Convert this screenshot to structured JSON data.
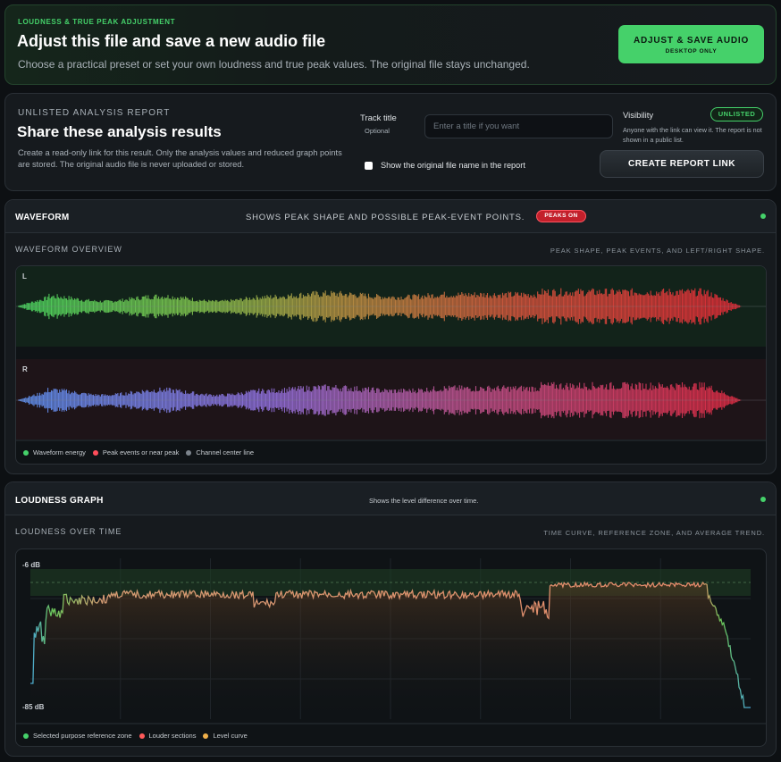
{
  "adjust": {
    "eyebrow": "LOUDNESS & TRUE PEAK ADJUSTMENT",
    "title": "Adjust this file and save a new audio file",
    "subtitle": "Choose a practical preset or set your own loudness and true peak values. The original file stays unchanged.",
    "button_label": "ADJUST & SAVE AUDIO",
    "button_sublabel": "DESKTOP ONLY"
  },
  "report": {
    "eyebrow": "UNLISTED ANALYSIS REPORT",
    "title": "Share these analysis results",
    "description": "Create a read-only link for this result. Only the analysis values and reduced graph points are stored. The original audio file is never uploaded or stored.",
    "track_title_label": "Track title",
    "track_title_optional": "Optional",
    "track_title_placeholder": "Enter a title if you want",
    "track_title_value": "",
    "show_filename_label": "Show the original file name in the report",
    "show_filename_checked": false,
    "visibility_label": "Visibility",
    "visibility_badge": "UNLISTED",
    "visibility_desc": "Anyone with the link can view it. The report is not shown in a public list.",
    "create_button": "CREATE REPORT LINK"
  },
  "waveform": {
    "title": "WAVEFORM",
    "note": "SHOWS PEAK SHAPE AND POSSIBLE PEAK-EVENT POINTS.",
    "badge": "PEAKS ON",
    "sub_title": "WAVEFORM OVERVIEW",
    "sub_right": "PEAK SHAPE, PEAK EVENTS, AND LEFT/RIGHT SHAPE.",
    "channels": [
      "L",
      "R"
    ],
    "legend": [
      {
        "label": "Waveform energy",
        "color": "#45d16a"
      },
      {
        "label": "Peak events or near peak",
        "color": "#ff4d5a"
      },
      {
        "label": "Channel center line",
        "color": "#7c848c"
      }
    ]
  },
  "loudness": {
    "title": "LOUDNESS GRAPH",
    "note": "Shows the level difference over time.",
    "sub_title": "LOUDNESS OVER TIME",
    "sub_right": "TIME CURVE, REFERENCE ZONE, AND AVERAGE TREND.",
    "y_top_label": "-6 dB",
    "y_bottom_label": "-85 dB",
    "legend": [
      {
        "label": "Selected purpose reference zone",
        "color": "#45d16a"
      },
      {
        "label": "Louder sections",
        "color": "#ff5a5a"
      },
      {
        "label": "Level curve",
        "color": "#f0b04a"
      }
    ]
  },
  "colors": {
    "accent": "#45d16a",
    "peak": "#ff4d5a",
    "background": "#0d1013"
  }
}
